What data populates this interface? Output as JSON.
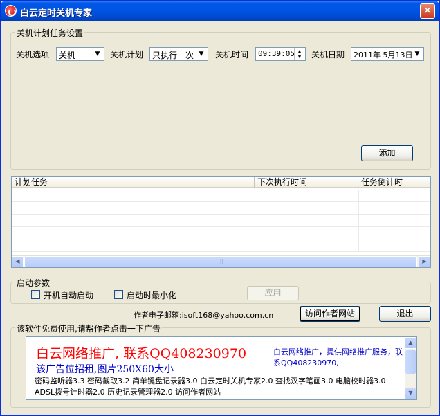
{
  "window": {
    "title": "白云定时关机专家",
    "close_glyph": "✕"
  },
  "settings_group": {
    "legend": "关机计划任务设置",
    "option_label": "关机选项",
    "option_value": "关机",
    "plan_label": "关机计划",
    "plan_value": "只执行一次",
    "time_label": "关机时间",
    "time_value": "09:39:05",
    "date_label": "关机日期",
    "date_value": "2011年 5月13日",
    "add_button": "添加"
  },
  "task_list": {
    "columns": [
      "计划任务",
      "下次执行时间",
      "任务倒计时"
    ],
    "rows": [],
    "scroll_grip": "|||"
  },
  "startup_group": {
    "legend": "启动参数",
    "autostart_label": "开机自动启动",
    "autostart_checked": false,
    "minimize_label": "启动时最小化",
    "minimize_checked": false,
    "apply_button": "应用"
  },
  "footer": {
    "email_label": "作者电子邮箱:isoft168@yahoo.com.cn",
    "visit_button": "访问作者网站",
    "exit_button": "退出"
  },
  "ad_group": {
    "legend": "该软件免费使用,请帮作者点击一下广告",
    "big_line1": "白云网络推广, 联系QQ408230970",
    "big_line2": "该广告位招租,图片250X60大小",
    "side_text": "白云网络推广，提供网络推广服务，联系QQ408230970,",
    "links_text": "密码监听器3.3 密码截取3.2 简单键盘记录器3.0 白云定时关机专家2.0 查找汉字笔画3.0 电脑校时器3.0 ADSL拨号计时器2.0 历史记录管理器2.0 访问作者网站"
  },
  "colors": {
    "titlebar": "#0054e3",
    "dialog_bg": "#ece9d8",
    "ad_red": "#ff0000",
    "ad_blue": "#0000cc"
  },
  "icons": [
    "app-icon",
    "close-icon",
    "dropdown-arrow-icon",
    "spin-up-icon",
    "spin-down-icon",
    "scroll-left-icon",
    "scroll-right-icon",
    "scroll-up-icon",
    "scroll-down-icon"
  ]
}
